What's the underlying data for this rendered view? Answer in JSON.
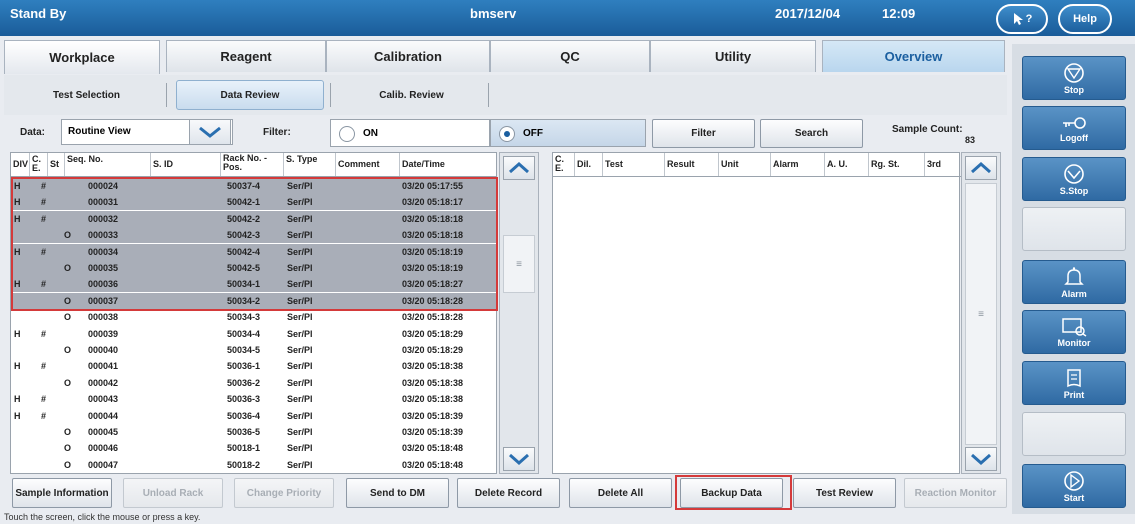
{
  "titlebar": {
    "status": "Stand By",
    "host": "bmserv",
    "date": "2017/12/04",
    "time": "12:09",
    "help_cursor": "?",
    "help": "Help"
  },
  "tabs": [
    "Workplace",
    "Reagent",
    "Calibration",
    "QC",
    "Utility",
    "Overview"
  ],
  "subtabs": [
    "Test Selection",
    "Data Review",
    "Calib. Review"
  ],
  "controls": {
    "data_label": "Data:",
    "data_value": "Routine View",
    "filter_label": "Filter:",
    "on": "ON",
    "off": "OFF",
    "filter_button": "Filter",
    "search_button": "Search",
    "sample_count_label": "Sample Count:",
    "sample_count": "83"
  },
  "left_table": {
    "headers": [
      "DIV",
      "C. E.",
      "St",
      "Seq. No.",
      "S. ID",
      "Rack No. - Pos.",
      "S. Type",
      "Comment",
      "Date/Time"
    ],
    "rows": [
      {
        "div": "H",
        "ce": "#",
        "st": "",
        "seq": "000024",
        "rack": "50037-4",
        "type": "Ser/Pl",
        "dt": "03/20 05:17:55",
        "sel": true
      },
      {
        "div": "H",
        "ce": "#",
        "st": "",
        "seq": "000031",
        "rack": "50042-1",
        "type": "Ser/Pl",
        "dt": "03/20 05:18:17",
        "sel": true
      },
      {
        "div": "H",
        "ce": "#",
        "st": "",
        "seq": "000032",
        "rack": "50042-2",
        "type": "Ser/Pl",
        "dt": "03/20 05:18:18",
        "sel": true
      },
      {
        "div": "",
        "ce": "",
        "st": "O",
        "seq": "000033",
        "rack": "50042-3",
        "type": "Ser/Pl",
        "dt": "03/20 05:18:18",
        "sel": true
      },
      {
        "div": "H",
        "ce": "#",
        "st": "",
        "seq": "000034",
        "rack": "50042-4",
        "type": "Ser/Pl",
        "dt": "03/20 05:18:19",
        "sel": true
      },
      {
        "div": "",
        "ce": "",
        "st": "O",
        "seq": "000035",
        "rack": "50042-5",
        "type": "Ser/Pl",
        "dt": "03/20 05:18:19",
        "sel": true
      },
      {
        "div": "H",
        "ce": "#",
        "st": "",
        "seq": "000036",
        "rack": "50034-1",
        "type": "Ser/Pl",
        "dt": "03/20 05:18:27",
        "sel": true
      },
      {
        "div": "",
        "ce": "",
        "st": "O",
        "seq": "000037",
        "rack": "50034-2",
        "type": "Ser/Pl",
        "dt": "03/20 05:18:28",
        "sel": true
      },
      {
        "div": "",
        "ce": "",
        "st": "O",
        "seq": "000038",
        "rack": "50034-3",
        "type": "Ser/Pl",
        "dt": "03/20 05:18:28",
        "sel": false
      },
      {
        "div": "H",
        "ce": "#",
        "st": "",
        "seq": "000039",
        "rack": "50034-4",
        "type": "Ser/Pl",
        "dt": "03/20 05:18:29",
        "sel": false
      },
      {
        "div": "",
        "ce": "",
        "st": "O",
        "seq": "000040",
        "rack": "50034-5",
        "type": "Ser/Pl",
        "dt": "03/20 05:18:29",
        "sel": false
      },
      {
        "div": "H",
        "ce": "#",
        "st": "",
        "seq": "000041",
        "rack": "50036-1",
        "type": "Ser/Pl",
        "dt": "03/20 05:18:38",
        "sel": false
      },
      {
        "div": "",
        "ce": "",
        "st": "O",
        "seq": "000042",
        "rack": "50036-2",
        "type": "Ser/Pl",
        "dt": "03/20 05:18:38",
        "sel": false
      },
      {
        "div": "H",
        "ce": "#",
        "st": "",
        "seq": "000043",
        "rack": "50036-3",
        "type": "Ser/Pl",
        "dt": "03/20 05:18:38",
        "sel": false
      },
      {
        "div": "H",
        "ce": "#",
        "st": "",
        "seq": "000044",
        "rack": "50036-4",
        "type": "Ser/Pl",
        "dt": "03/20 05:18:39",
        "sel": false
      },
      {
        "div": "",
        "ce": "",
        "st": "O",
        "seq": "000045",
        "rack": "50036-5",
        "type": "Ser/Pl",
        "dt": "03/20 05:18:39",
        "sel": false
      },
      {
        "div": "",
        "ce": "",
        "st": "O",
        "seq": "000046",
        "rack": "50018-1",
        "type": "Ser/Pl",
        "dt": "03/20 05:18:48",
        "sel": false
      },
      {
        "div": "",
        "ce": "",
        "st": "O",
        "seq": "000047",
        "rack": "50018-2",
        "type": "Ser/Pl",
        "dt": "03/20 05:18:48",
        "sel": false
      }
    ]
  },
  "right_table": {
    "headers": [
      "C. E.",
      "Dil.",
      "Test",
      "Result",
      "Unit",
      "Alarm",
      "A. U.",
      "Rg. St.",
      "3rd"
    ]
  },
  "bottom_buttons": [
    {
      "label": "Sample Information",
      "disabled": false
    },
    {
      "label": "Unload Rack",
      "disabled": true
    },
    {
      "label": "Change Priority",
      "disabled": true
    },
    {
      "label": "Send to DM",
      "disabled": false
    },
    {
      "label": "Delete Record",
      "disabled": false
    },
    {
      "label": "Delete All",
      "disabled": false
    },
    {
      "label": "Backup Data",
      "disabled": false
    },
    {
      "label": "Test Review",
      "disabled": false
    },
    {
      "label": "Reaction Monitor",
      "disabled": true
    }
  ],
  "side_panel": {
    "stop": "Stop",
    "logoff": "Logoff",
    "sstop": "S.Stop",
    "alarm": "Alarm",
    "monitor": "Monitor",
    "print": "Print",
    "start": "Start"
  },
  "footer": "Touch the screen, click the mouse or press a key."
}
